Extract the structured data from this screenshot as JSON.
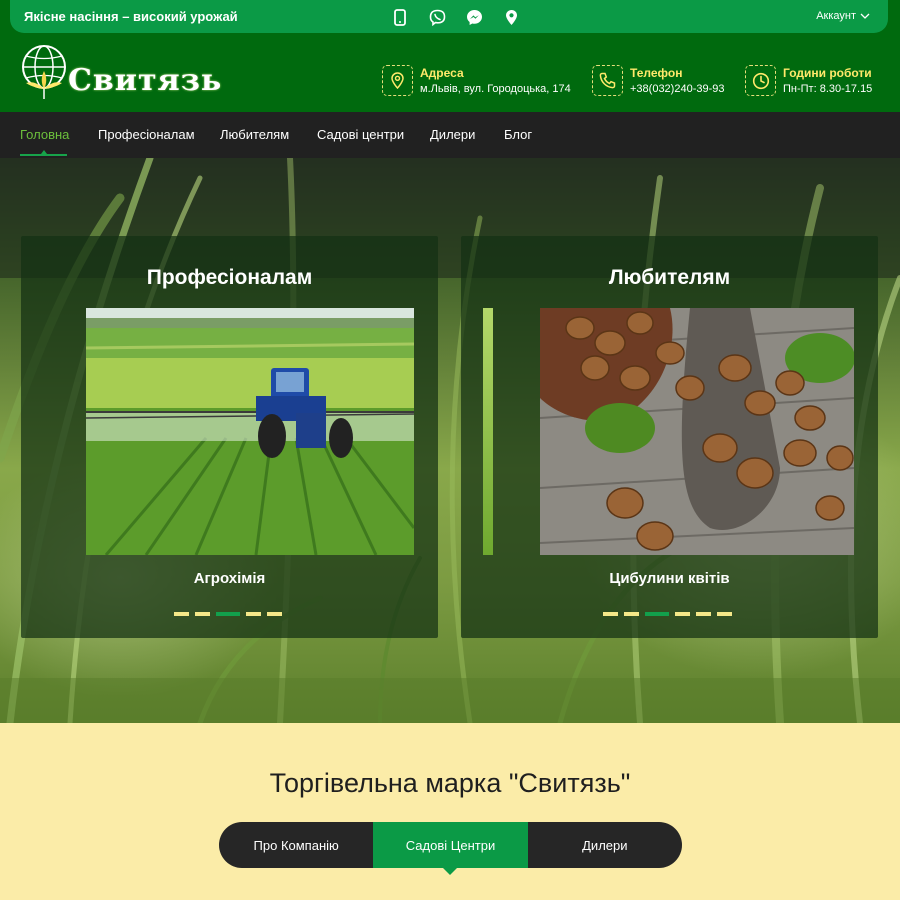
{
  "topbar": {
    "slogan": "Якісне насіння – високий урожай",
    "quick_icons": [
      "phone-icon",
      "viber-icon",
      "messenger-icon",
      "location-pin-icon"
    ],
    "account_label": "Аккаунт"
  },
  "header": {
    "logo_text": "Свитязь",
    "contacts": [
      {
        "icon": "location-pin-icon",
        "label": "Адреса",
        "value": "м.Львів, вул. Городоцька, 174"
      },
      {
        "icon": "phone-icon",
        "label": "Телефон",
        "value": "+38(032)240-39-93"
      },
      {
        "icon": "clock-icon",
        "label": "Години роботи",
        "value": "Пн-Пт: 8.30-17.15"
      }
    ]
  },
  "nav": {
    "items": [
      "Головна",
      "Професіоналам",
      "Любителям",
      "Садові центри",
      "Дилери",
      "Блог"
    ],
    "active_index": 0
  },
  "hero": {
    "cards": [
      {
        "title": "Професіоналам",
        "caption": "Агрохімія",
        "slide_count": 5,
        "active_slide": 2
      },
      {
        "title": "Любителям",
        "caption": "Цибулини квітів",
        "slide_count": 6,
        "active_slide": 2
      }
    ]
  },
  "brand": {
    "title": "Торгівельна марка \"Свитязь\"",
    "tabs": [
      "Про Компанію",
      "Садові Центри",
      "Дилери"
    ],
    "active_tab": 1
  },
  "colors": {
    "brand_green": "#0b9a46",
    "dark_green": "#006a0e",
    "nav_dark": "#212121",
    "accent_yellow": "#ffe96b",
    "section_bg": "#fbeca8"
  }
}
